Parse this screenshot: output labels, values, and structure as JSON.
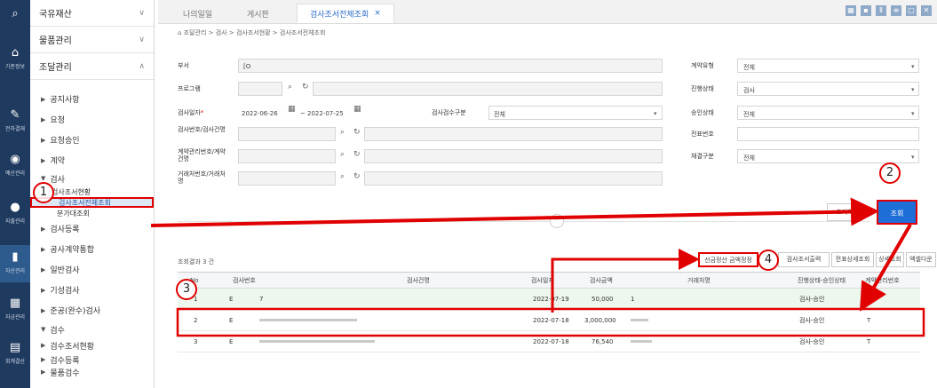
{
  "rail": {
    "items": [
      {
        "icon": "search-icon",
        "label": ""
      },
      {
        "icon": "home-icon",
        "label": "기준정보"
      },
      {
        "icon": "approval-icon",
        "label": "전자결재"
      },
      {
        "icon": "budget-icon",
        "label": "예산관리"
      },
      {
        "icon": "expense-icon",
        "label": "지출관리"
      },
      {
        "icon": "asset-icon",
        "label": "자산관리"
      },
      {
        "icon": "fund-icon",
        "label": "자금관리"
      },
      {
        "icon": "accounting-icon",
        "label": "회계결산"
      }
    ]
  },
  "sidebar": {
    "sections": [
      {
        "label": "국유재산",
        "chev": "∨"
      },
      {
        "label": "물품관리",
        "chev": "∨"
      },
      {
        "label": "조달관리",
        "chev": "∧"
      }
    ],
    "items": [
      "공지사항",
      "요청",
      "요청승인",
      "계약",
      "검사"
    ],
    "sub": [
      "검사조서현황"
    ],
    "sub2": [
      "검사조서전체조회",
      "분가대조회"
    ],
    "items2": [
      "검사등록",
      "공사계약통합",
      "일반검사",
      "기성검사",
      "준공(완수)검사"
    ],
    "section2": "검수",
    "items3": [
      "검수조서현황",
      "검수등록",
      "물품검수"
    ]
  },
  "tabs": [
    {
      "label": "나의일일"
    },
    {
      "label": "게시판"
    },
    {
      "label": "검사조서전체조회",
      "close": "×"
    }
  ],
  "breadcrumb": "조달관리 > 검사 > 검사조서현황 > 검사조서전체조회",
  "form": {
    "dept_label": "부서",
    "dept_value": "[O",
    "program_label": "프로그램",
    "date_label": "검사일자",
    "date_req": "*",
    "date_from": "2022-06-26",
    "date_sep": "~",
    "date_to": "2022-07-25",
    "inspect_type_label": "검사검수구분",
    "inspect_type_value": "전체",
    "inspect_no_label": "검사번호/검사건명",
    "contract_no_label": "계약관리번호/계약건명",
    "vendor_label": "거래처번호/거래처명",
    "contract_type_label": "계약유형",
    "contract_type_value": "전체",
    "progress_label": "진행상태",
    "progress_value": "검사",
    "approval_label": "승인상태",
    "approval_value": "전체",
    "voucher_label": "전표번호",
    "pay_label": "채결구분",
    "pay_value": "전체",
    "reset_label": "초기화",
    "search_label": "조회"
  },
  "results": {
    "count": "조회결과 3 건",
    "buttons": [
      "선금정산 금액정정",
      "검사조서출력",
      "전표상세조회",
      "상세조회",
      "엑셀다운로드"
    ]
  },
  "grid": {
    "headers": [
      "No",
      "검사번호",
      "검사건명",
      "검사일자",
      "검사금액",
      "거래처명",
      "진행상태-승인상태",
      "계약관리번호"
    ],
    "rows": [
      {
        "no": "1",
        "id": "E",
        "name": "7",
        "date": "2022-07-19",
        "amount": "50,000",
        "vendor": "1",
        "status": "검사-승인",
        "contract": "T"
      },
      {
        "no": "2",
        "id": "E",
        "name": "",
        "date": "2022-07-18",
        "amount": "3,000,000",
        "vendor": "",
        "status": "검사-승인",
        "contract": "T"
      },
      {
        "no": "3",
        "id": "E",
        "name": "",
        "date": "2022-07-18",
        "amount": "76,540",
        "vendor": "",
        "status": "검사-승인",
        "contract": "T"
      }
    ]
  },
  "annotations": {
    "c1": "1",
    "c2": "2",
    "c3": "3",
    "c4": "4"
  },
  "colors": {
    "accent": "#1e6ed8",
    "annotation": "#e00000",
    "rail": "#1f3a5f"
  }
}
